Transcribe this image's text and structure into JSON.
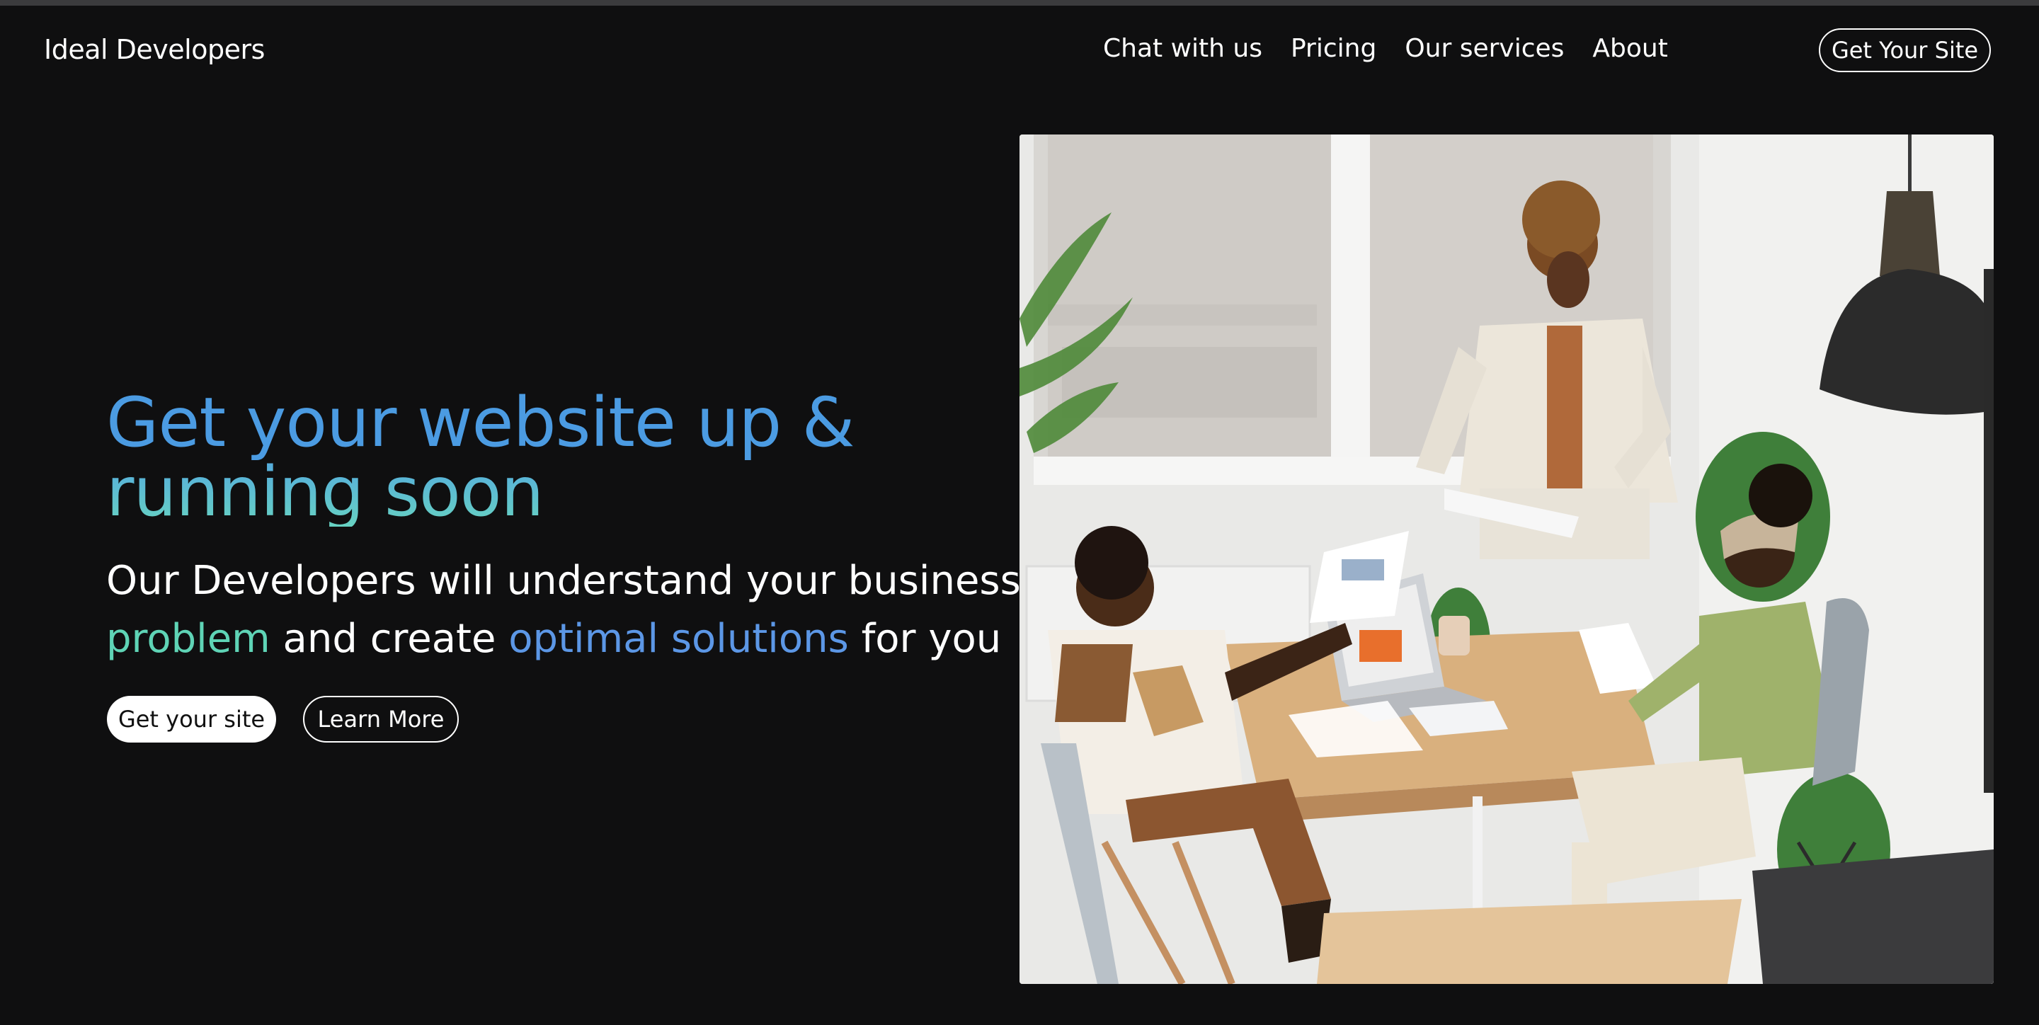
{
  "brand": "Ideal Developers",
  "nav": {
    "items": [
      "Chat with us",
      "Pricing",
      "Our services",
      "About"
    ],
    "cta": "Get Your Site"
  },
  "hero": {
    "headline_line1": "Get your website up &",
    "headline_line2": "running soon",
    "sub_part1": "Our Developers will understand your business",
    "sub_green": "problem",
    "sub_mid": "and create",
    "sub_blue": "optimal solutions",
    "sub_end": "for you",
    "primary_button": "Get your site",
    "secondary_button": "Learn More"
  },
  "colors": {
    "background": "#0f0f10",
    "headline_blue": "#4b9be2",
    "headline_teal": "#67d2c2",
    "accent_green": "#5fd4b6",
    "accent_blue": "#5c97e6"
  }
}
